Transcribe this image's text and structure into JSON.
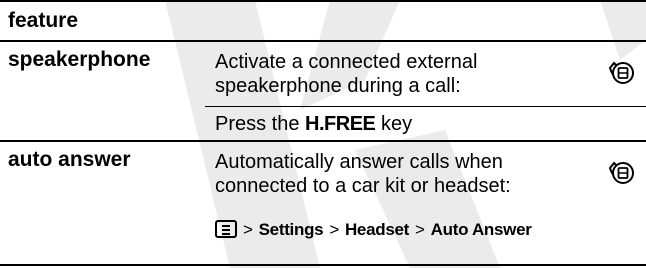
{
  "header": {
    "label": "feature"
  },
  "rows": [
    {
      "name": "speakerphone",
      "description": "Activate a connected external speakerphone during a call:",
      "instruction": {
        "prefix": "Press the ",
        "key": "H.FREE",
        "suffix": " key"
      },
      "icon": "optional-feature-icon"
    },
    {
      "name": "auto answer",
      "description": "Automatically answer calls when connected to a car kit or headset:",
      "path": [
        "Settings",
        "Headset",
        "Auto Answer"
      ],
      "path_separator": ">",
      "menu_icon": "menu-key-icon",
      "icon": "optional-feature-icon"
    }
  ]
}
